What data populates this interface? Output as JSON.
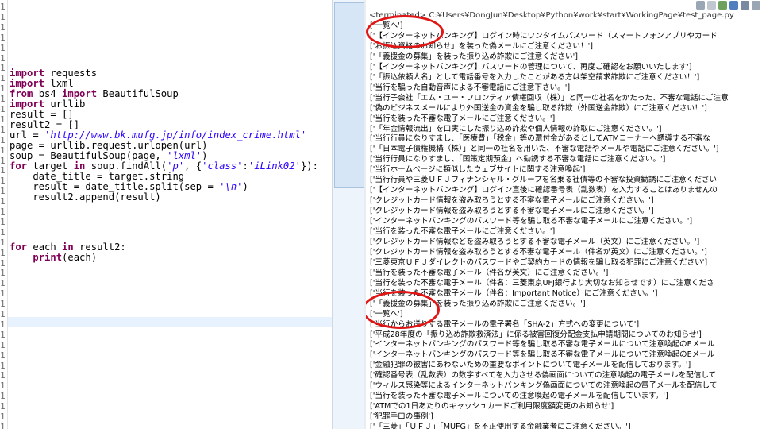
{
  "editor": {
    "line_numbers": [
      "1",
      "1",
      "1",
      "1",
      "1",
      "1",
      "1",
      "1",
      "1",
      "1",
      "1",
      "1",
      "1",
      "1",
      "1",
      "1",
      "1",
      "1",
      "1",
      "1",
      "1",
      "1",
      "1",
      "1",
      "1",
      "1",
      "1",
      "1",
      "1",
      "1",
      "1",
      "1",
      "1",
      "1",
      "1",
      "1",
      "1",
      "1",
      "1",
      "1",
      "1",
      "1"
    ],
    "code": [
      [
        {
          "t": "import",
          "c": "kw"
        },
        {
          "t": " requests",
          "c": "fn"
        }
      ],
      [
        {
          "t": "import",
          "c": "kw"
        },
        {
          "t": " lxml",
          "c": "fn"
        }
      ],
      [
        {
          "t": "from",
          "c": "kw"
        },
        {
          "t": " bs4 ",
          "c": "fn"
        },
        {
          "t": "import",
          "c": "kw"
        },
        {
          "t": " BeautifulSoup",
          "c": "fn"
        }
      ],
      [
        {
          "t": "import",
          "c": "kw"
        },
        {
          "t": " urllib",
          "c": "fn"
        }
      ],
      [
        {
          "t": "result = []",
          "c": "fn"
        }
      ],
      [
        {
          "t": "result2 = []",
          "c": "fn"
        }
      ],
      [
        {
          "t": "url = ",
          "c": "fn"
        },
        {
          "t": "'http://www.bk.mufg.jp/info/index_crime.html'",
          "c": "str"
        }
      ],
      [
        {
          "t": "page = urllib.request.urlopen(url)",
          "c": "fn"
        }
      ],
      [
        {
          "t": "soup = BeautifulSoup(page, ",
          "c": "fn"
        },
        {
          "t": "'lxml'",
          "c": "str"
        },
        {
          "t": ")",
          "c": "fn"
        }
      ],
      [
        {
          "t": "for",
          "c": "kw"
        },
        {
          "t": " target ",
          "c": "fn"
        },
        {
          "t": "in",
          "c": "kw"
        },
        {
          "t": " soup.findAll(",
          "c": "fn"
        },
        {
          "t": "'p'",
          "c": "str"
        },
        {
          "t": ", {",
          "c": "fn"
        },
        {
          "t": "'class'",
          "c": "str"
        },
        {
          "t": ":",
          "c": "fn"
        },
        {
          "t": "'iLink02'",
          "c": "str"
        },
        {
          "t": "}):",
          "c": "fn"
        }
      ],
      [
        {
          "t": "    date_title = target.string",
          "c": "fn"
        }
      ],
      [
        {
          "t": "    result = date_title.split(sep = ",
          "c": "fn"
        },
        {
          "t": "'\\n'",
          "c": "str"
        },
        {
          "t": ")",
          "c": "fn"
        }
      ],
      [
        {
          "t": "    result2.append(result)",
          "c": "fn"
        }
      ],
      [
        {
          "t": "for",
          "c": "kw"
        },
        {
          "t": " each ",
          "c": "fn"
        },
        {
          "t": "in",
          "c": "kw"
        },
        {
          "t": " result2:",
          "c": "fn"
        }
      ],
      [
        {
          "t": "    ",
          "c": "fn"
        },
        {
          "t": "print",
          "c": "kw"
        },
        {
          "t": "(each)",
          "c": "fn"
        }
      ]
    ]
  },
  "console": {
    "title": "<terminated> C:¥Users¥DongJun¥Desktop¥Python¥work¥start¥WorkingPage¥test_page.py",
    "lines": [
      "['一覧へ']",
      "['【インターネットバンキング】ログイン時にワンタイムパスワード（スマートフォンアプリやカード",
      "['お振込資格のお知らせ」を装った偽メールにご注意ください！']",
      "['「義援金の募集」を装った振り込め詐欺にご注意ください']",
      "['【インターネットバンキング】パスワードの管理について、再度ご確認をお願いいたします']",
      "['「振込依頼人名」として電話番号を入力したことがある方は架空請求詐欺にご注意ください！']",
      "['当行を騙った自動音声による不審電話にご注意下さい。']",
      "['当行子会社「エム・ユー・フロンティア債権回収（株）」と同一の社名をかたった、不審な電話にご注意",
      "['偽のビジネスメールにより外国送金の資金を騙し取る詐欺（外国送金詐欺）にご注意ください！']",
      "['当行を装った不審な電子メールにご注意ください。']",
      "['「年金情報流出」を口実にした振り込め詐欺や個人情報の詐取にご注意ください。']",
      "['当行行員になりすまし、「医療費」「税金」等の還付金があるとしてATMコーナーへ誘導する不審な",
      "['「日本電子債権機構（株）」と同一の社名を用いた、不審な電話やメールや電話にご注意ください。']",
      "['当行行員になりすまし、「国策定期預金」へ勧誘する不審な電話にご注意ください。']",
      "['当行ホームページに類似したウェブサイトに関する注意喚起']",
      "['当行行員や三菱ＵＦＪフィナンシャル・グループを名乗る社債等の不審な投資勧誘にご注意ください",
      "['【インターネットバンキング】ログイン直後に確認番号表（乱数表）を入力することはありませんの",
      "['クレジットカード情報を盗み取ろうとする不審な電子メールにご注意ください。']",
      "['クレジットカード情報を盗み取ろうとする不審な電子メールにご注意ください。']",
      "['インターネットバンキングのパスワード等を騙し取る不審な電子メールにご注意ください。']",
      "['当行を装った不審な電子メールにご注意ください。']",
      "['クレジットカード情報などを盗み取ろうとする不審な電子メール（英文）にご注意ください。']",
      "['クレジットカード情報を盗み取ろうとする不審な電子メール（件名が英文）にご注意ください。']",
      "['三菱東京ＵＦＪダイレクトのパスワードやご契約カードの情報を騙し取る犯罪にご注意ください']",
      "['当行を装った不審な電子メール（件名が英文）にご注意ください。']",
      "['当行を装った不審な電子メール（件名：三菱東京UFJ銀行より大切なお知らせです）にご注意くださ",
      "['当行を装った不審な電子メール（件名：Important Notice）にご注意ください。']",
      "['「義援金の募集」を装った振り込め詐欺にご注意ください。']",
      "['一覧へ']",
      "['当行からお送りする電子メールの電子署名「SHA-2」方式への変更について']",
      "['平成28年度の「振り込め詐欺救済法」に係る被害回復分配金支払申請期間についてのお知らせ']",
      "['インターネットバンキングのパスワード等を騙し取る不審な電子メールについて注意喚起のEメール",
      "['インターネットバンキングのパスワード等を騙し取る不審な電子メールについて注意喚起のEメール",
      "['金融犯罪の被害にあわないための重要なポイントについて電子メールを配信しております。']",
      "['確認番号表（乱数表）の数字すべてを入力させる偽画面についての注意喚起の電子メールを配信して",
      "['ウィルス感染等によるインターネットバンキング偽画面についての注意喚起の電子メールを配信して",
      "['当行を装った不審な電子メールについての注意喚起の電子メールを配信しています。']",
      "['ATMでの1日あたりのキャッシュカードご利用限度額変更のお知らせ']",
      "['犯罪手口の事例']",
      "['「三菱」「ＵＦＪ」「MUFG」を不正使用する金融業者にご注意ください。']"
    ]
  },
  "colors": {
    "annotation": "#e01515",
    "keyword": "#7f0055",
    "string": "#2a00ff"
  }
}
